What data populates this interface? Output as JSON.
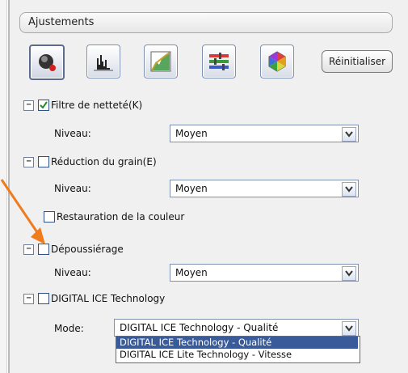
{
  "header": {
    "title": "Ajustements"
  },
  "toolbar": {
    "icons": [
      "unsharp-mask-icon",
      "histogram-icon",
      "tone-curve-icon",
      "color-balance-icon",
      "color-palette-icon"
    ],
    "reset_label": "Réinitialiser"
  },
  "sections": {
    "sharpness": {
      "label": "Filtre de netteté(K)",
      "checked": true,
      "level_label": "Niveau:",
      "level_value": "Moyen"
    },
    "grain": {
      "label": "Réduction du grain(E)",
      "checked": false,
      "level_label": "Niveau:",
      "level_value": "Moyen"
    },
    "color_restore": {
      "label": "Restauration de la couleur",
      "checked": false
    },
    "dust": {
      "label": "Dépoussiérage",
      "checked": false,
      "level_label": "Niveau:",
      "level_value": "Moyen"
    },
    "ice": {
      "label": "DIGITAL ICE Technology",
      "checked": false,
      "mode_label": "Mode:",
      "mode_value": "DIGITAL ICE Technology - Qualité",
      "options": [
        "DIGITAL ICE Technology - Qualité",
        "DIGITAL ICE Lite Technology - Vitesse"
      ]
    }
  },
  "colors": {
    "annotation_arrow": "#f07b1c",
    "selection": "#3a5b99"
  }
}
